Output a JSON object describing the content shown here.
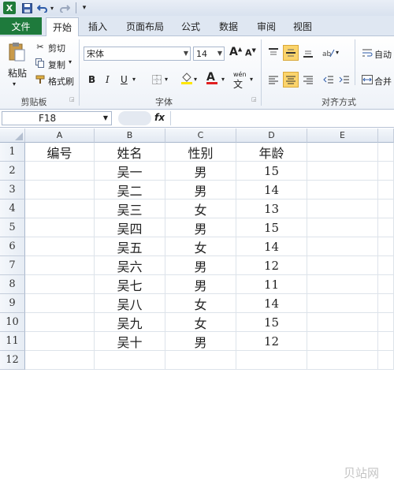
{
  "app": {
    "logo": "X",
    "quick_access": [
      "save-icon",
      "undo-icon",
      "redo-icon",
      "customize-icon"
    ]
  },
  "tabs": {
    "file": "文件",
    "items": [
      {
        "label": "开始",
        "active": true
      },
      {
        "label": "插入",
        "active": false
      },
      {
        "label": "页面布局",
        "active": false
      },
      {
        "label": "公式",
        "active": false
      },
      {
        "label": "数据",
        "active": false
      },
      {
        "label": "审阅",
        "active": false
      },
      {
        "label": "视图",
        "active": false
      }
    ]
  },
  "ribbon": {
    "clipboard": {
      "paste": "粘贴",
      "cut": "剪切",
      "copy": "复制",
      "format_painter": "格式刷",
      "group_label": "剪贴板"
    },
    "font": {
      "font_name": "宋体",
      "font_size": "14",
      "bold": "B",
      "italic": "I",
      "underline": "U",
      "grow": "A",
      "shrink": "A",
      "font_color_glyph": "A",
      "phonetic": "wén",
      "group_label": "字体"
    },
    "alignment": {
      "wrap_text": "自动",
      "merge": "合并",
      "group_label": "对齐方式"
    },
    "accent_color": "#1e7a3c",
    "highlight_color": "#fbd46b"
  },
  "formula_bar": {
    "name_box": "F18",
    "fx": "fx",
    "content": ""
  },
  "grid": {
    "columns": [
      "A",
      "B",
      "C",
      "D",
      "E"
    ],
    "rows": [
      "1",
      "2",
      "3",
      "4",
      "5",
      "6",
      "7",
      "8",
      "9",
      "10",
      "11",
      "12"
    ],
    "headers": {
      "A": "编号",
      "B": "姓名",
      "C": "性别",
      "D": "年龄"
    },
    "data": [
      {
        "name": "吴一",
        "gender": "男",
        "age": "15"
      },
      {
        "name": "吴二",
        "gender": "男",
        "age": "14"
      },
      {
        "name": "吴三",
        "gender": "女",
        "age": "13"
      },
      {
        "name": "吴四",
        "gender": "男",
        "age": "15"
      },
      {
        "name": "吴五",
        "gender": "女",
        "age": "14"
      },
      {
        "name": "吴六",
        "gender": "男",
        "age": "12"
      },
      {
        "name": "吴七",
        "gender": "男",
        "age": "11"
      },
      {
        "name": "吴八",
        "gender": "女",
        "age": "14"
      },
      {
        "name": "吴九",
        "gender": "女",
        "age": "15"
      },
      {
        "name": "吴十",
        "gender": "男",
        "age": "12"
      }
    ]
  },
  "watermark": "贝站网"
}
